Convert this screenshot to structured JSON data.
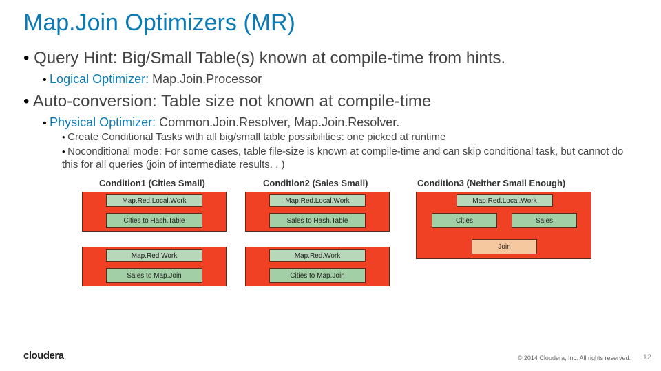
{
  "title": "Map.Join Optimizers (MR)",
  "b1a": "Query Hint: Big/Small Table(s) known at compile-time from hints.",
  "b2a_accent": "Logical Optimizer:",
  "b2a_rest": " Map.Join.Processor",
  "b1b": "Auto-conversion: Table size not known at compile-time",
  "b2b_accent": "Physical Optimizer:",
  "b2b_rest": " Common.Join.Resolver, Map.Join.Resolver.",
  "b3a": "Create Conditional Tasks with all big/small table possibilities: one picked at runtime",
  "b3b": "Noconditional mode: For some cases, table file-size is known at compile-time and can skip conditional task, but cannot do this for all queries (join of intermediate results. . )",
  "cond1": "Condition1 (Cities Small)",
  "cond2": "Condition2 (Sales Small)",
  "cond3": "Condition3 (Neither Small Enough)",
  "head_local": "Map.Red.Local.Work",
  "head_mr": "Map.Red.Work",
  "c1_hash": "Cities to Hash.Table",
  "c1_mj": "Sales to Map.Join",
  "c2_hash": "Sales to Hash.Table",
  "c2_mj": "Cities to Map.Join",
  "c3_cities": "Cities",
  "c3_sales": "Sales",
  "c3_join": "Join",
  "logo": "cloudera",
  "copyright": "© 2014 Cloudera, Inc. All rights reserved.",
  "pagenum": "12"
}
